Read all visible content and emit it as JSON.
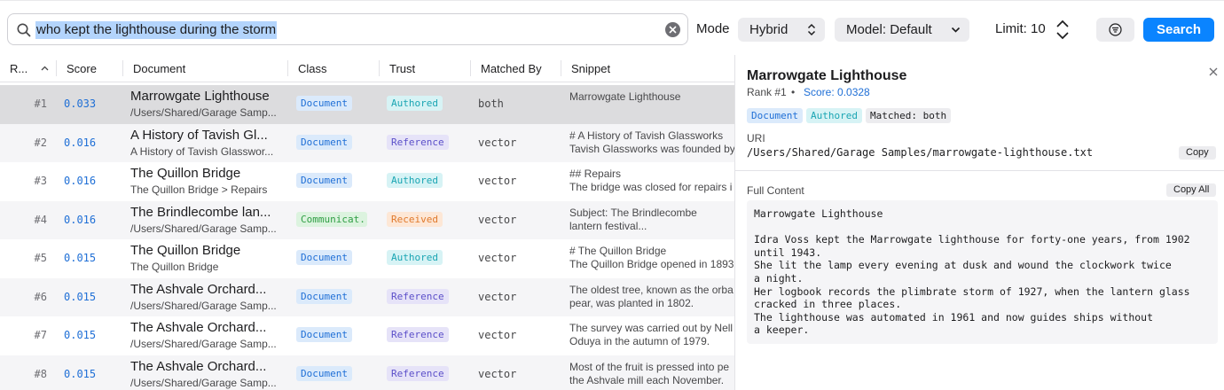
{
  "search": {
    "query": "who kept the lighthouse during the storm",
    "mode_label": "Mode",
    "mode_value": "Hybrid",
    "model_value": "Model: Default",
    "limit_label": "Limit: 10",
    "search_button": "Search"
  },
  "table": {
    "headers": {
      "rank": "R...",
      "score": "Score",
      "document": "Document",
      "class": "Class",
      "trust": "Trust",
      "matched_by": "Matched By",
      "snippet": "Snippet"
    },
    "rows": [
      {
        "rank": "#1",
        "score": "0.033",
        "title": "Marrowgate Lighthouse",
        "subtitle": "/Users/Shared/Garage Samp...",
        "class": "Document",
        "trust": "Authored",
        "matched": "both",
        "snippet1": "Marrowgate Lighthouse",
        "snippet2": ""
      },
      {
        "rank": "#2",
        "score": "0.016",
        "title": "A History of Tavish Gl...",
        "subtitle": "A History of Tavish Glasswor...",
        "class": "Document",
        "trust": "Reference",
        "matched": "vector",
        "snippet1": "# A History of Tavish Glassworks",
        "snippet2": "Tavish Glassworks was founded by"
      },
      {
        "rank": "#3",
        "score": "0.016",
        "title": "The Quillon Bridge",
        "subtitle": "The Quillon Bridge > Repairs",
        "class": "Document",
        "trust": "Authored",
        "matched": "vector",
        "snippet1": "## Repairs",
        "snippet2": "The bridge was closed for repairs i"
      },
      {
        "rank": "#4",
        "score": "0.016",
        "title": "The Brindlecombe lan...",
        "subtitle": "/Users/Shared/Garage Samp...",
        "class": "Communicat...",
        "trust": "Received",
        "matched": "vector",
        "snippet1": "Subject: The Brindlecombe",
        "snippet2": "lantern festival..."
      },
      {
        "rank": "#5",
        "score": "0.015",
        "title": "The Quillon Bridge",
        "subtitle": "The Quillon Bridge",
        "class": "Document",
        "trust": "Authored",
        "matched": "vector",
        "snippet1": "# The Quillon Bridge",
        "snippet2": "The Quillon Bridge opened in 1893"
      },
      {
        "rank": "#6",
        "score": "0.015",
        "title": "The Ashvale Orchard...",
        "subtitle": "/Users/Shared/Garage Samp...",
        "class": "Document",
        "trust": "Reference",
        "matched": "vector",
        "snippet1": "The oldest tree, known as the orba",
        "snippet2": "pear, was planted in 1802."
      },
      {
        "rank": "#7",
        "score": "0.015",
        "title": "The Ashvale Orchard...",
        "subtitle": "/Users/Shared/Garage Samp...",
        "class": "Document",
        "trust": "Reference",
        "matched": "vector",
        "snippet1": "The survey was carried out by Nell",
        "snippet2": "Oduya in the autumn of 1979."
      },
      {
        "rank": "#8",
        "score": "0.015",
        "title": "The Ashvale Orchard...",
        "subtitle": "/Users/Shared/Garage Samp...",
        "class": "Document",
        "trust": "Reference",
        "matched": "vector",
        "snippet1": "Most of the fruit is pressed into pe",
        "snippet2": "the Ashvale mill each November."
      }
    ]
  },
  "detail": {
    "title": "Marrowgate Lighthouse",
    "rank": "Rank #1",
    "separator": "•",
    "score": "Score: 0.0328",
    "badges": {
      "class": "Document",
      "trust": "Authored",
      "matched": "Matched: both"
    },
    "uri_label": "URI",
    "uri": "/Users/Shared/Garage Samples/marrowgate-lighthouse.txt",
    "copy_label": "Copy",
    "content_label": "Full Content",
    "copy_all_label": "Copy All",
    "content": "Marrowgate Lighthouse\n\nIdra Voss kept the Marrowgate lighthouse for forty-one years, from 1902\nuntil 1943.\nShe lit the lamp every evening at dusk and wound the clockwork twice\na night.\nHer logbook records the plimbrate storm of 1927, when the lantern glass\ncracked in three places.\nThe lighthouse was automated in 1961 and now guides ships without\na keeper."
  },
  "colors": {
    "accent": "#0a84ff",
    "score_blue": "#1f6fd6",
    "badge_document_bg": "#dbeafb",
    "badge_document_fg": "#1f6fd6",
    "badge_authored_bg": "#d7f3f5",
    "badge_authored_fg": "#1aa5b3",
    "badge_reference_bg": "#e6e3f8",
    "badge_reference_fg": "#5b4fc9",
    "badge_received_bg": "#fde7d6",
    "badge_received_fg": "#e0792c",
    "badge_communication_bg": "#dcf3df",
    "badge_communication_fg": "#2f9e44"
  }
}
